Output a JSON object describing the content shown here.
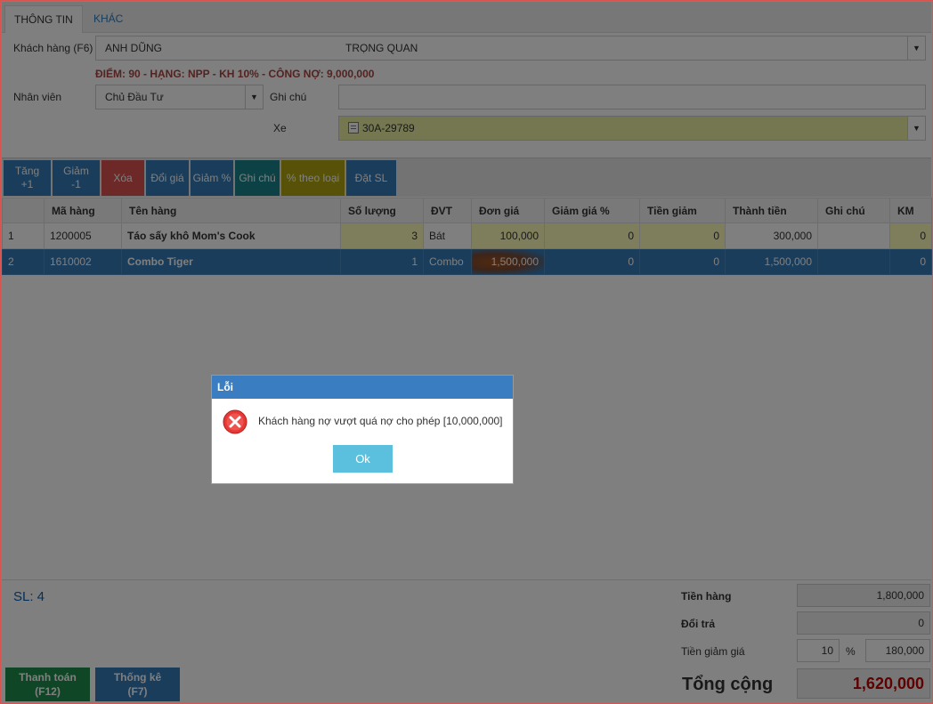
{
  "tabs": [
    "THÔNG TIN",
    "KHÁC"
  ],
  "form": {
    "customer_label": "Khách hàng (F6)",
    "customer_name": "ANH DŨNG",
    "customer_company": "TRỌNG QUAN",
    "points_line": "ĐIỂM: 90 - HẠNG: NPP - KH 10% - CÔNG NỢ: 9,000,000",
    "staff_label": "Nhân viên",
    "staff_value": "Chủ Đầu Tư",
    "note_label": "Ghi chú",
    "note_value": "",
    "vehicle_label": "Xe",
    "vehicle_value": "30A-29789"
  },
  "toolbar": [
    {
      "label": "Tăng\n+1",
      "color": "#337ab7"
    },
    {
      "label": "Giảm\n-1",
      "color": "#337ab7"
    },
    {
      "label": "Xóa",
      "color": "#d9534f"
    },
    {
      "label": "Đổi giá",
      "color": "#337ab7"
    },
    {
      "label": "Giảm %",
      "color": "#337ab7"
    },
    {
      "label": "Ghi chú",
      "color": "#18848d"
    },
    {
      "label": "% theo loại",
      "color": "#b0a512"
    },
    {
      "label": "Đặt SL",
      "color": "#337ab7"
    }
  ],
  "table": {
    "columns": [
      "",
      "Mã hàng",
      "Tên hàng",
      "Số lượng",
      "ĐVT",
      "Đơn giá",
      "Giảm giá %",
      "Tiền giảm",
      "Thành tiền",
      "Ghi chú",
      "KM"
    ],
    "rows": [
      [
        "1",
        "1200005",
        "Táo sấy khô Mom's Cook",
        "3",
        "Bát",
        "100,000",
        "0",
        "0",
        "300,000",
        "",
        "0"
      ],
      [
        "2",
        "1610002",
        "Combo Tiger",
        "1",
        "Combo",
        "1,500,000",
        "0",
        "0",
        "1,500,000",
        "",
        "0"
      ]
    ]
  },
  "footer": {
    "sl": "SL: 4",
    "goods_label": "Tiền hàng",
    "goods_value": "1,800,000",
    "return_label": "Đổi trả",
    "return_value": "0",
    "discount_label": "Tiền giảm giá",
    "discount_percent": "10",
    "percent_sign": "%",
    "discount_value": "180,000",
    "total_label": "Tổng cộng",
    "total_value": "1,620,000",
    "pay_button": "Thanh toán\n(F12)",
    "stats_button": "Thống kê\n(F7)"
  },
  "modal": {
    "title": "Lỗi",
    "message": "Khách hàng nợ vượt quá nợ cho phép [10,000,000]",
    "ok": "Ok"
  },
  "colors": {
    "primary": "#337ab7",
    "danger": "#d9534f",
    "teal": "#18848d",
    "olive": "#b0a512",
    "success": "#1e8c4a",
    "total": "#c00000"
  }
}
